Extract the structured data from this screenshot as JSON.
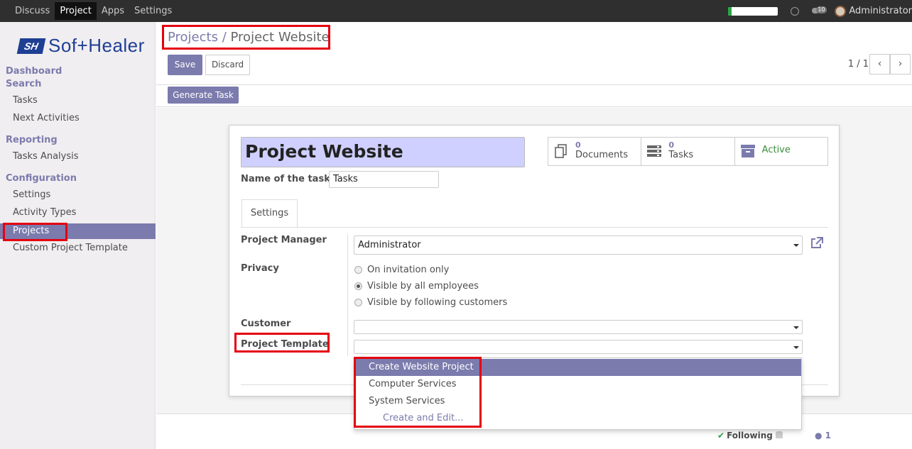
{
  "topbar": {
    "menus": [
      "Discuss",
      "Project",
      "Apps",
      "Settings"
    ],
    "active_menu": "Project",
    "chat_badge": "10",
    "user": "Administrator"
  },
  "brand": {
    "mark": "SH",
    "name": "Sof+Healer"
  },
  "sidebar": {
    "sections": {
      "dashboard": "Dashboard",
      "search": "Search",
      "reporting": "Reporting",
      "configuration": "Configuration"
    },
    "items": {
      "tasks": "Tasks",
      "next_activities": "Next Activities",
      "tasks_analysis": "Tasks Analysis",
      "settings": "Settings",
      "activity_types": "Activity Types",
      "projects": "Projects",
      "custom_template": "Custom Project Template"
    },
    "active_item": "Projects"
  },
  "control_panel": {
    "breadcrumb": {
      "parent": "Projects",
      "separator": "/",
      "current": "Project Website"
    },
    "buttons": {
      "save": "Save",
      "discard": "Discard",
      "generate_task": "Generate Task"
    },
    "pager": "1 / 1",
    "pager_prev": "‹",
    "pager_next": "›"
  },
  "form": {
    "name": "Project Website",
    "tasks_label_caption": "Name of the tasks :",
    "tasks_label_value": "Tasks",
    "smart_buttons": {
      "documents": {
        "count": "0",
        "label": "Documents"
      },
      "tasks": {
        "count": "0",
        "label": "Tasks"
      },
      "active": {
        "label": "Active"
      }
    },
    "tab": "Settings",
    "project_manager_label": "Project Manager",
    "project_manager_value": "Administrator",
    "privacy_label": "Privacy",
    "privacy_options": [
      "On invitation only",
      "Visible by all employees",
      "Visible by following customers"
    ],
    "privacy_selected": "Visible by all employees",
    "customer_label": "Customer",
    "customer_value": "",
    "template_label": "Project Template",
    "template_value": ""
  },
  "template_dropdown": {
    "options": [
      "Create Website Project",
      "Computer Services",
      "System Services"
    ],
    "highlighted": "Create Website Project",
    "create_edit": "Create and Edit..."
  },
  "chatter": {
    "following": "Following",
    "followers": "1"
  },
  "colors": {
    "brand": "#7c7bad",
    "topbar": "#2f2f2f",
    "highlight": "#e5000f",
    "name_bg": "#cfd0ff"
  }
}
